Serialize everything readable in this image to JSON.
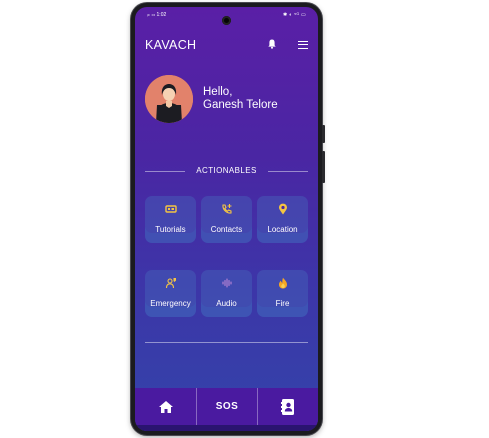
{
  "status_bar": {
    "time_signal": "ᵢₗₗ ₊ₗₗ 1:02",
    "icons": "✱ ◐ ⁵ᴳ ▭"
  },
  "header": {
    "title": "KAVACH",
    "bell_icon": "bell-icon",
    "menu_icon": "hamburger-menu-icon"
  },
  "profile": {
    "greeting": "Hello,",
    "name": "Ganesh Telore",
    "avatar_icon": "user-avatar"
  },
  "section": {
    "label": "ACTIONABLES"
  },
  "tiles": [
    {
      "label": "Tutorials",
      "icon": "tutorial-icon"
    },
    {
      "label": "Contacts",
      "icon": "phone-add-icon"
    },
    {
      "label": "Location",
      "icon": "location-pin-icon"
    },
    {
      "label": "Emergency",
      "icon": "emergency-icon"
    },
    {
      "label": "Audio",
      "icon": "audio-wave-icon"
    },
    {
      "label": "Fire",
      "icon": "fire-icon"
    }
  ],
  "bottom_nav": {
    "home_icon": "home-icon",
    "sos_label": "SOS",
    "contacts_icon": "contact-book-icon"
  },
  "colors": {
    "accent": "#f5c542",
    "background_top": "#5a1fa6",
    "background_bottom": "#3344aa",
    "navbar": "#4a1aa0"
  }
}
